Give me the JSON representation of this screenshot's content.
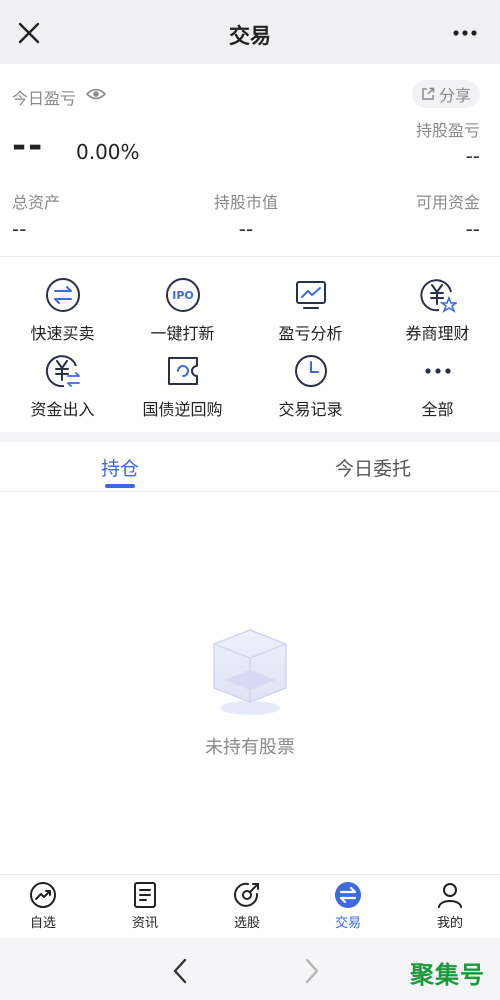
{
  "header": {
    "title": "交易"
  },
  "profit": {
    "today_label": "今日盈亏",
    "today_value": "--",
    "today_pct": "0.00%",
    "share_label": "分享",
    "holding_label": "持股盈亏",
    "holding_value": "--"
  },
  "summary": [
    {
      "label": "总资产",
      "value": "--"
    },
    {
      "label": "持股市值",
      "value": "--"
    },
    {
      "label": "可用资金",
      "value": "--"
    }
  ],
  "actions": [
    {
      "label": "快速买卖",
      "icon": "exchange-icon"
    },
    {
      "label": "一键打新",
      "icon": "ipo-icon"
    },
    {
      "label": "盈亏分析",
      "icon": "monitor-chart-icon"
    },
    {
      "label": "券商理财",
      "icon": "yuan-star-icon"
    },
    {
      "label": "资金出入",
      "icon": "yuan-transfer-icon"
    },
    {
      "label": "国债逆回购",
      "icon": "bond-ticket-icon"
    },
    {
      "label": "交易记录",
      "icon": "clock-icon"
    },
    {
      "label": "全部",
      "icon": "more-dots-icon"
    }
  ],
  "tabs": [
    {
      "label": "持仓",
      "active": true
    },
    {
      "label": "今日委托",
      "active": false
    }
  ],
  "empty": {
    "label": "未持有股票",
    "icon": "empty-box-icon"
  },
  "bottom_nav": [
    {
      "label": "自选",
      "icon": "trend-circle-icon"
    },
    {
      "label": "资讯",
      "icon": "document-icon"
    },
    {
      "label": "选股",
      "icon": "target-icon"
    },
    {
      "label": "交易",
      "icon": "exchange-filled-icon",
      "active": true
    },
    {
      "label": "我的",
      "icon": "person-icon"
    }
  ],
  "browser": {
    "back": "back-chevron-icon",
    "forward": "forward-chevron-icon"
  },
  "watermark": "聚集号",
  "colors": {
    "accent": "#3c6ae0",
    "icon_dark": "#2a2f4a"
  }
}
